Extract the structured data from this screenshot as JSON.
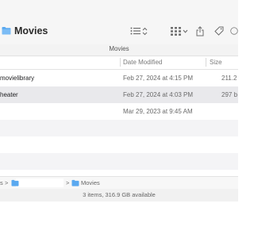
{
  "window": {
    "title": "Movies",
    "path_title": "Movies"
  },
  "toolbar": {
    "list_view_icon": "list-view-icon",
    "sort_icon": "up-down-chevron-icon",
    "grid_view_icon": "icon-grid-icon",
    "chevron_icon": "chevron-down-icon",
    "share_icon": "share-icon",
    "tag_icon": "tag-icon",
    "more_icon": "more-icon"
  },
  "columns": {
    "date_modified": "Date Modified",
    "size": "Size"
  },
  "files": [
    {
      "name": "movielibrary",
      "date": "Feb 27, 2024 at 4:15 PM",
      "size": "211.2"
    },
    {
      "name": "heater",
      "date": "Feb 27, 2024 at 4:03 PM",
      "size": "297 b"
    },
    {
      "name": "",
      "date": "Mar 29, 2023 at 9:45 AM",
      "size": ""
    }
  ],
  "pathbar": {
    "sep1": "s",
    "sep2": ">",
    "current": "Movies"
  },
  "status": "3 items, 316.9 GB available",
  "colors": {
    "folder": "#5aa9f0",
    "toolbar_bg": "#f6f6f6",
    "row_alt": "#f4f4f6"
  }
}
